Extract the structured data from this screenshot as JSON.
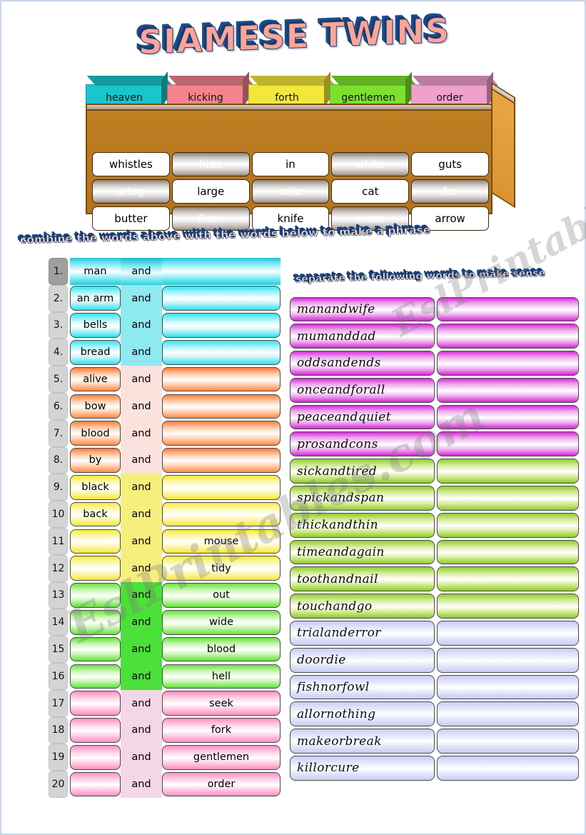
{
  "title": {
    "part1": "SIAMESE",
    "part2": "TWINS"
  },
  "box": {
    "lids": [
      {
        "label": "heaven",
        "color": "#19c6cc"
      },
      {
        "label": "kicking",
        "color": "#f4838e"
      },
      {
        "label": "forth",
        "color": "#f2e83c"
      },
      {
        "label": "gentlemen",
        "color": "#7ce02c"
      },
      {
        "label": "order",
        "color": "#f0a0cc"
      }
    ],
    "cells": [
      {
        "text": "whistles",
        "visible": true
      },
      {
        "text": "hide",
        "visible": false
      },
      {
        "text": "in",
        "visible": true
      },
      {
        "text": "white",
        "visible": false
      },
      {
        "text": "guts",
        "visible": true
      },
      {
        "text": "a leg",
        "visible": false
      },
      {
        "text": "large",
        "visible": true
      },
      {
        "text": "wife",
        "visible": false
      },
      {
        "text": "cat",
        "visible": true
      },
      {
        "text": "fro",
        "visible": false
      },
      {
        "text": "butter",
        "visible": true
      },
      {
        "text": "flesh",
        "visible": false
      },
      {
        "text": "knife",
        "visible": true
      },
      {
        "text": "meat",
        "visible": false
      },
      {
        "text": "arrow",
        "visible": true
      }
    ]
  },
  "instructions": {
    "left": "combine the words above with the words below to make a phrase",
    "right": "separate the following words to make sense"
  },
  "left_table": {
    "conjunction": "and",
    "rows": [
      {
        "num": "1.",
        "first": "man",
        "second": "",
        "color": "cyan"
      },
      {
        "num": "2.",
        "first": "an arm",
        "second": "",
        "color": "cyan"
      },
      {
        "num": "3.",
        "first": "bells",
        "second": "",
        "color": "cyan"
      },
      {
        "num": "4.",
        "first": "bread",
        "second": "",
        "color": "cyan"
      },
      {
        "num": "5.",
        "first": "alive",
        "second": "",
        "color": "orange"
      },
      {
        "num": "6.",
        "first": "bow",
        "second": "",
        "color": "orange"
      },
      {
        "num": "7.",
        "first": "blood",
        "second": "",
        "color": "orange"
      },
      {
        "num": "8.",
        "first": "by",
        "second": "",
        "color": "orange"
      },
      {
        "num": "9.",
        "first": "black",
        "second": "",
        "color": "yellow"
      },
      {
        "num": "10",
        "first": "back",
        "second": "",
        "color": "yellow"
      },
      {
        "num": "11",
        "first": "",
        "second": "mouse",
        "color": "yellow"
      },
      {
        "num": "12",
        "first": "",
        "second": "tidy",
        "color": "yellow"
      },
      {
        "num": "13",
        "first": "",
        "second": "out",
        "color": "green"
      },
      {
        "num": "14",
        "first": "",
        "second": "wide",
        "color": "green"
      },
      {
        "num": "15",
        "first": "",
        "second": "blood",
        "color": "green"
      },
      {
        "num": "16",
        "first": "",
        "second": "hell",
        "color": "green"
      },
      {
        "num": "17",
        "first": "",
        "second": "seek",
        "color": "pink"
      },
      {
        "num": "18",
        "first": "",
        "second": "fork",
        "color": "pink"
      },
      {
        "num": "19",
        "first": "",
        "second": "gentlemen",
        "color": "pink"
      },
      {
        "num": "20",
        "first": "",
        "second": "order",
        "color": "pink"
      }
    ]
  },
  "right_table": {
    "rows": [
      {
        "word": "manandwife",
        "color": "magenta"
      },
      {
        "word": "mumanddad",
        "color": "magenta"
      },
      {
        "word": "oddsandends",
        "color": "magenta"
      },
      {
        "word": "onceandforall",
        "color": "magenta"
      },
      {
        "word": "peaceandquiet",
        "color": "magenta"
      },
      {
        "word": "prosandcons",
        "color": "magenta"
      },
      {
        "word": "sickandtired",
        "color": "lime"
      },
      {
        "word": "spickandspan",
        "color": "lime"
      },
      {
        "word": "thickandthin",
        "color": "lime"
      },
      {
        "word": "timeandagain",
        "color": "lime"
      },
      {
        "word": "toothandnail",
        "color": "lime"
      },
      {
        "word": "touchandgo",
        "color": "lime"
      },
      {
        "word": "trialanderror",
        "color": "lav"
      },
      {
        "word": "doordie",
        "color": "lav"
      },
      {
        "word": "fishnorfowl",
        "color": "lav"
      },
      {
        "word": "allornothing",
        "color": "lav"
      },
      {
        "word": "makeorbreak",
        "color": "lav"
      },
      {
        "word": "killorcure",
        "color": "lav"
      }
    ]
  },
  "watermark": {
    "text": "EslPrintables.com"
  }
}
